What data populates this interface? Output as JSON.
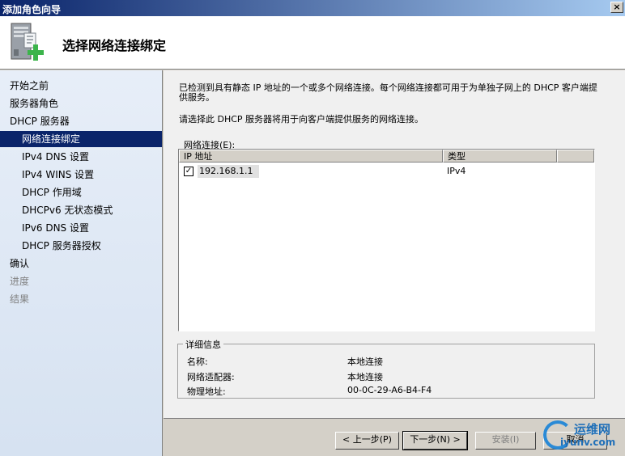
{
  "window": {
    "title": "添加角色向导",
    "close_symbol": "×"
  },
  "header": {
    "page_title": "选择网络连接绑定",
    "icon": "server-add-icon"
  },
  "sidebar": {
    "items": [
      {
        "label": "开始之前",
        "state": "normal"
      },
      {
        "label": "服务器角色",
        "state": "normal"
      },
      {
        "label": "DHCP 服务器",
        "state": "normal"
      },
      {
        "label": "网络连接绑定",
        "state": "active"
      },
      {
        "label": "IPv4 DNS 设置",
        "state": "normal"
      },
      {
        "label": "IPv4 WINS 设置",
        "state": "normal"
      },
      {
        "label": "DHCP 作用域",
        "state": "normal"
      },
      {
        "label": "DHCPv6 无状态模式",
        "state": "normal"
      },
      {
        "label": "IPv6 DNS 设置",
        "state": "normal"
      },
      {
        "label": "DHCP 服务器授权",
        "state": "normal"
      },
      {
        "label": "确认",
        "state": "normal"
      },
      {
        "label": "进度",
        "state": "disabled"
      },
      {
        "label": "结果",
        "state": "disabled"
      }
    ]
  },
  "main": {
    "description": "已检测到具有静态 IP 地址的一个或多个网络连接。每个网络连接都可用于为单独子网上的 DHCP 客户端提供服务。",
    "instruction": "请选择此 DHCP 服务器将用于向客户端提供服务的网络连接。",
    "list_label": "网络连接(E):",
    "columns": [
      "IP 地址",
      "类型"
    ],
    "rows": [
      {
        "checked": true,
        "check_symbol": "✓",
        "ip": "192.168.1.1",
        "type": "IPv4"
      }
    ]
  },
  "details": {
    "legend": "详细信息",
    "fields": [
      {
        "key": "名称:",
        "value": "本地连接"
      },
      {
        "key": "网络适配器:",
        "value": "本地连接"
      },
      {
        "key": "物理地址:",
        "value": "00-0C-29-A6-B4-F4"
      }
    ]
  },
  "buttons": {
    "back": "< 上一步(P)",
    "next": "下一步(N) >",
    "install": "安装(I)",
    "cancel": "取消"
  },
  "watermark": {
    "line1": "运维网",
    "line2": "iyunv.com"
  },
  "colors": {
    "accent": "#0a246a",
    "sidebar_top": "#e7eef8",
    "watermark": "#1f6fb8"
  }
}
